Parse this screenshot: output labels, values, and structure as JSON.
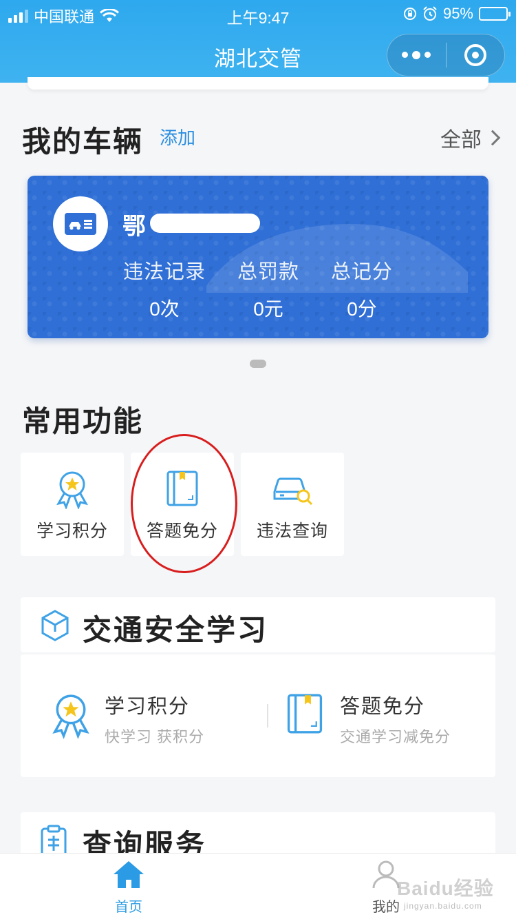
{
  "status_bar": {
    "carrier": "中国联通",
    "time": "上午9:47",
    "battery": "95%"
  },
  "nav": {
    "title": "湖北交管"
  },
  "vehicles": {
    "title": "我的车辆",
    "add_label": "添加",
    "all_label": "全部",
    "card": {
      "plate": "鄂",
      "stats": [
        {
          "label": "违法记录",
          "value": "0次"
        },
        {
          "label": "总罚款",
          "value": "0元"
        },
        {
          "label": "总记分",
          "value": "0分"
        }
      ]
    }
  },
  "common": {
    "title": "常用功能",
    "items": [
      {
        "label": "学习积分",
        "icon": "medal-icon"
      },
      {
        "label": "答题免分",
        "icon": "book-icon"
      },
      {
        "label": "违法查询",
        "icon": "car-search-icon"
      }
    ]
  },
  "safety": {
    "title": "交通安全学习",
    "items": [
      {
        "title": "学习积分",
        "subtitle": "快学习 获积分"
      },
      {
        "title": "答题免分",
        "subtitle": "交通学习减免分"
      }
    ]
  },
  "query": {
    "title": "查询服务"
  },
  "tabbar": {
    "home": "首页",
    "mine": "我的"
  },
  "watermark": {
    "text": "Baidu经验",
    "sub": "jingyan.baidu.com"
  },
  "colors": {
    "accent": "#2ea8ee",
    "card": "#2f6fd6",
    "annotation": "#d81e1e"
  }
}
